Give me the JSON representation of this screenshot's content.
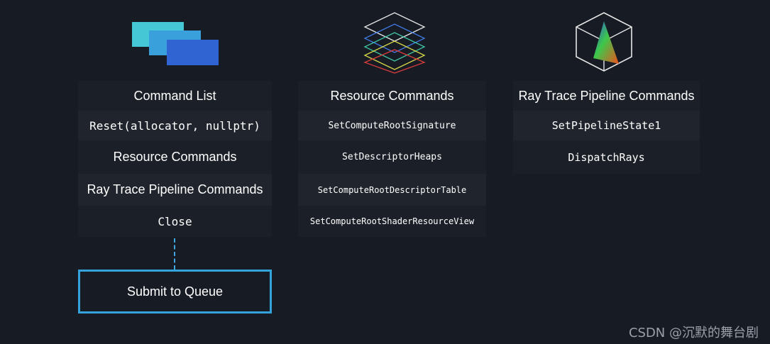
{
  "icons": {
    "command_list": "stacked-pages-icon",
    "resource_commands": "stacked-layers-icon",
    "ray_trace": "cube-with-triangle-icon"
  },
  "colors": {
    "background": "#171b24",
    "accent": "#34a3dc",
    "page_cyan": "#45c7d6",
    "page_mid": "#3aa0dc",
    "page_blue": "#2f64d2"
  },
  "command_list": {
    "title": "Command List",
    "items": [
      "Reset(allocator, nullptr)",
      "Resource Commands",
      "Ray Trace Pipeline Commands",
      "Close"
    ]
  },
  "resource_commands": {
    "title": "Resource Commands",
    "items": [
      "SetComputeRootSignature",
      "SetDescriptorHeaps",
      "SetComputeRootDescriptorTable",
      "SetComputeRootShaderResourceView"
    ]
  },
  "ray_trace": {
    "title": "Ray Trace Pipeline Commands",
    "items": [
      "SetPipelineState1",
      "DispatchRays"
    ]
  },
  "submit": {
    "label": "Submit to Queue"
  },
  "watermark": "CSDN @沉默的舞台剧"
}
